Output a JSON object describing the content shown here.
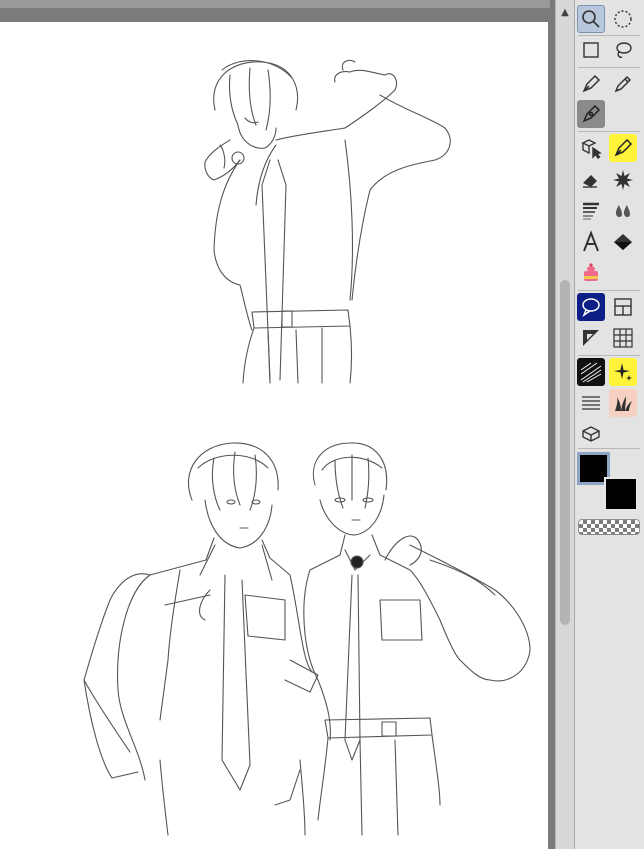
{
  "canvas": {
    "background": "#ffffff",
    "sketch_color": "#555555"
  },
  "toolbar": {
    "tools": [
      {
        "name": "zoom",
        "icon": "magnifier-icon",
        "selected": true
      },
      {
        "name": "lasso-select",
        "icon": "dotted-lasso-icon",
        "selected": false
      },
      {
        "name": "rect-select",
        "icon": "rectangle-select-icon",
        "selected": false
      },
      {
        "name": "lasso",
        "icon": "lasso-icon",
        "selected": false
      },
      {
        "name": "pen",
        "icon": "pen-nib-icon",
        "selected": false
      },
      {
        "name": "pencil",
        "icon": "pencil-icon",
        "selected": false
      },
      {
        "name": "ink-pen",
        "icon": "ink-pen-icon",
        "selected": true
      },
      {
        "name": "object",
        "icon": "object-cursor-icon",
        "selected": false
      },
      {
        "name": "marker",
        "icon": "yellow-pen-icon",
        "selected": false
      },
      {
        "name": "eraser",
        "icon": "eraser-icon",
        "selected": false
      },
      {
        "name": "decoration",
        "icon": "sparkle-burst-icon",
        "selected": false
      },
      {
        "name": "gradient",
        "icon": "gradient-lines-icon",
        "selected": false
      },
      {
        "name": "blend",
        "icon": "droplets-icon",
        "selected": false
      },
      {
        "name": "text",
        "icon": "text-a-icon",
        "selected": false
      },
      {
        "name": "fill",
        "icon": "fill-bucket-icon",
        "selected": false
      },
      {
        "name": "cake",
        "icon": "cake-icon",
        "selected": false
      },
      {
        "name": "balloon",
        "icon": "speech-balloon-icon",
        "selected": false
      },
      {
        "name": "frame",
        "icon": "frame-border-icon",
        "selected": false
      },
      {
        "name": "ruler",
        "icon": "triangle-ruler-icon",
        "selected": false
      },
      {
        "name": "perspective",
        "icon": "perspective-grid-icon",
        "selected": false
      },
      {
        "name": "speedlines",
        "icon": "speed-lines-icon",
        "selected": false
      },
      {
        "name": "effect",
        "icon": "star-effect-icon",
        "selected": false
      },
      {
        "name": "hatching",
        "icon": "hatching-lines-icon",
        "selected": false
      },
      {
        "name": "grass",
        "icon": "grass-icon",
        "selected": false
      },
      {
        "name": "3d-object",
        "icon": "cube-icon",
        "selected": false
      }
    ]
  },
  "colors": {
    "main": "#000000",
    "sub": "#000000",
    "transparent": "checkered"
  }
}
